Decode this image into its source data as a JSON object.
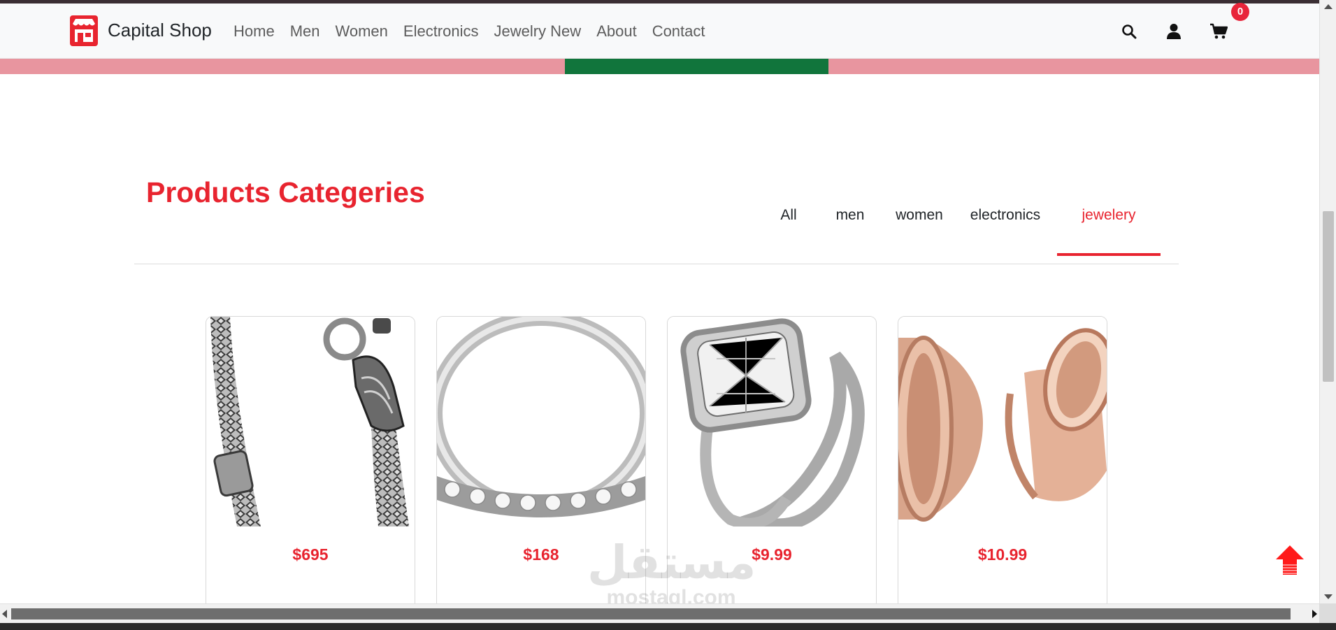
{
  "navbar": {
    "brand": "Capital Shop",
    "links": [
      "Home",
      "Men",
      "Women",
      "Electronics",
      "Jewelry New",
      "About",
      "Contact"
    ],
    "icons": [
      "search-icon",
      "user-icon",
      "cart-icon"
    ],
    "cart_count": "0"
  },
  "section": {
    "title": "Products Categeries",
    "tabs": [
      "All",
      "men",
      "women",
      "electronics",
      "jewelery"
    ],
    "active_tab": "jewelery"
  },
  "products": [
    {
      "price": "$695",
      "image": "silver-chain-bracelet"
    },
    {
      "price": "$168",
      "image": "diamond-band-ring"
    },
    {
      "price": "$9.99",
      "image": "halo-engagement-ring-set"
    },
    {
      "price": "$10.99",
      "image": "rose-gold-tunnel-plugs"
    }
  ],
  "watermark": {
    "arabic": "مستقل",
    "latin": "mostaql.com"
  },
  "colors": {
    "accent": "#e8242f",
    "badge": "#e8243a",
    "hero_pink": "#e8959f",
    "hero_green": "#11753c",
    "navbar_bg": "#f8f9fa"
  }
}
